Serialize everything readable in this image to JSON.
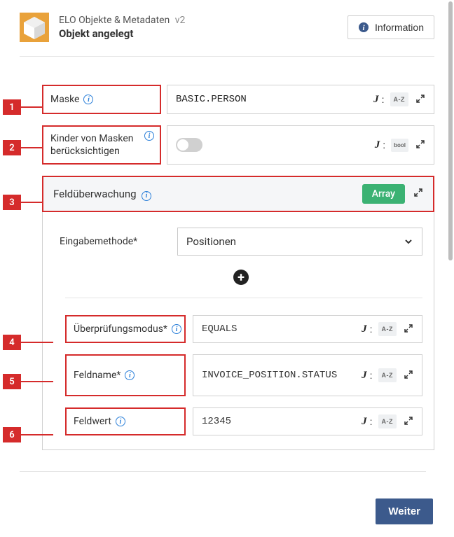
{
  "header": {
    "title": "ELO Objekte & Metadaten",
    "version": "v2",
    "subtitle": "Objekt angelegt",
    "info_btn": "Information"
  },
  "callouts": [
    "1",
    "2",
    "3",
    "4",
    "5",
    "6"
  ],
  "fields": {
    "maske": {
      "label": "Maske",
      "value": "BASIC.PERSON",
      "type": "A-Z"
    },
    "kinder": {
      "label": "Kinder von Masken berücksichtigen",
      "type": "bool"
    },
    "feldueber": {
      "label": "Feldüberwachung",
      "badge": "Array"
    },
    "eingabe": {
      "label": "Eingabemethode*",
      "value": "Positionen"
    },
    "modus": {
      "label": "Überprüfungsmodus*",
      "value": "EQUALS",
      "type": "A-Z"
    },
    "feldname": {
      "label": "Feldname*",
      "value": "INVOICE_POSITION.STATUS",
      "type": "A-Z"
    },
    "feldwert": {
      "label": "Feldwert",
      "value": "12345",
      "type": "A-Z"
    }
  },
  "footer": {
    "next": "Weiter"
  }
}
